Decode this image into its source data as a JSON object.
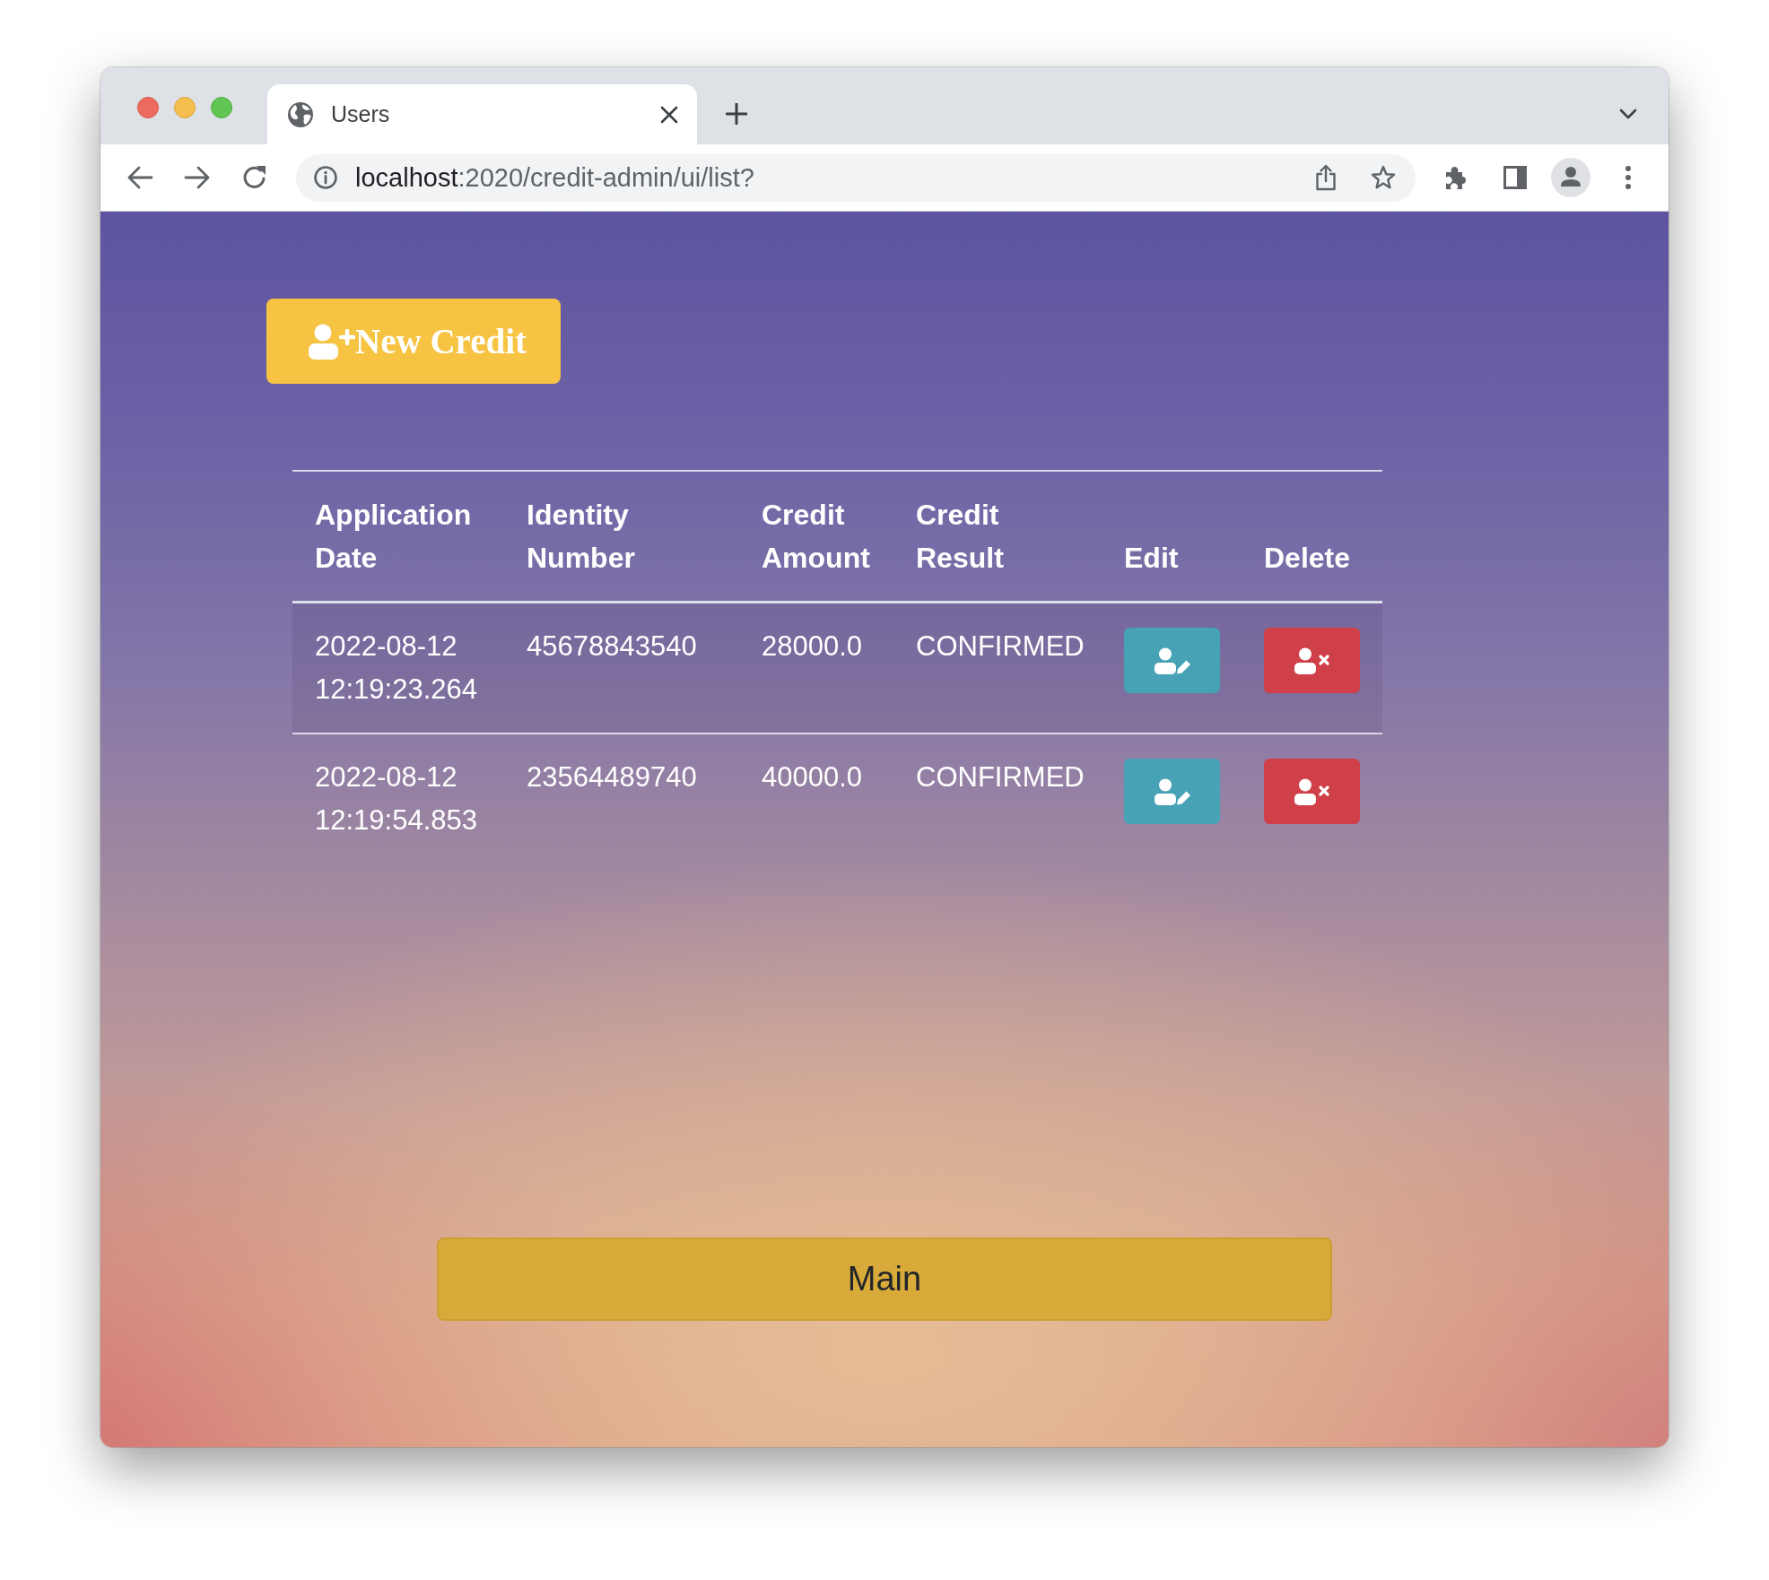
{
  "browser": {
    "tabs": [
      {
        "title": "Users",
        "selected": true
      }
    ],
    "address": {
      "host": "localhost",
      "path": ":2020/credit-admin/ui/list?"
    }
  },
  "toolbar": {
    "new_button": "New Credit"
  },
  "table": {
    "columns": [
      "Application Date",
      "Identity Number",
      "Credit Amount",
      "Credit Result",
      "Edit",
      "Delete"
    ],
    "rows": [
      {
        "cells": [
          "2022-08-12 12:19:23.264",
          "45678843540",
          "28000.0",
          "CONFIRMED"
        ]
      },
      {
        "cells": [
          "2022-08-12 12:19:54.853",
          "23564489740",
          "40000.0",
          "CONFIRMED"
        ]
      }
    ]
  },
  "footer": {
    "main_button": "Main"
  }
}
